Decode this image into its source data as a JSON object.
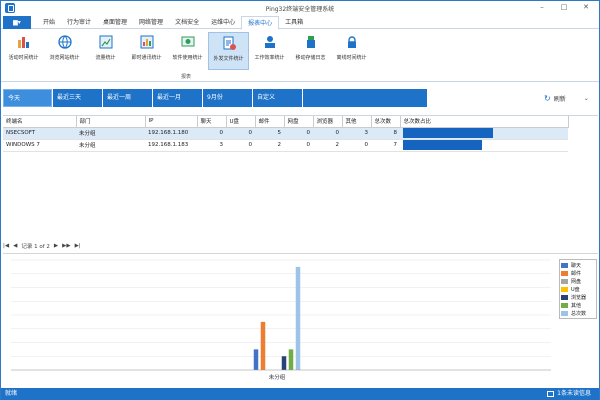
{
  "window": {
    "title": "Ping32终端安全管理系统",
    "min": "–",
    "max": "□",
    "close": "✕"
  },
  "menu": {
    "file_label": "▆▾",
    "tabs": [
      "开始",
      "行为审计",
      "桌面管理",
      "网络管理",
      "文档安全",
      "运维中心",
      "报表中心",
      "工具箱"
    ],
    "active_tab": 6
  },
  "ribbon": {
    "buttons": [
      {
        "label": "活动时间统计",
        "icon": "activity-time-icon"
      },
      {
        "label": "浏览网站统计",
        "icon": "globe-icon"
      },
      {
        "label": "流量统计",
        "icon": "traffic-icon"
      },
      {
        "label": "即时通讯统计",
        "icon": "chat-icon"
      },
      {
        "label": "软件使用统计",
        "icon": "software-icon"
      },
      {
        "label": "外发文件统计",
        "icon": "outgoing-file-icon"
      },
      {
        "label": "工作效率统计",
        "icon": "efficiency-icon"
      },
      {
        "label": "移动存储日志",
        "icon": "usb-icon"
      },
      {
        "label": "离线时间统计",
        "icon": "offline-time-icon"
      }
    ],
    "active_index": 5,
    "group_label": "报表"
  },
  "dates": {
    "options": [
      "今天",
      "最近三天",
      "最近一周",
      "最近一月",
      "9月份",
      "自定义"
    ],
    "active_index": 0
  },
  "refresh": {
    "label": "刷新"
  },
  "table": {
    "columns": [
      "终端名",
      "部门",
      "IP",
      "聊天",
      "U盘",
      "邮件",
      "网盘",
      "浏览器",
      "其他",
      "总次数",
      "总次数占比"
    ],
    "rows": [
      {
        "name": "NSECSOFT",
        "dept": "未分组",
        "ip": "192.168.1.180",
        "chat": "0",
        "udisk": "0",
        "mail": "5",
        "netdisk": "0",
        "browser": "0",
        "other": "3",
        "total": "8",
        "ratio": 1.0
      },
      {
        "name": "WINDOWS 7",
        "dept": "未分组",
        "ip": "192.168.1.183",
        "chat": "3",
        "udisk": "0",
        "mail": "2",
        "netdisk": "0",
        "browser": "2",
        "other": "0",
        "total": "7",
        "ratio": 0.875
      }
    ]
  },
  "pager": {
    "nav_first": "|◀",
    "nav_prev": "◀",
    "text": "记录 1 of 2",
    "nav_next": "▶",
    "nav_next_page": "▶▶",
    "nav_last": "▶|"
  },
  "chart_data": {
    "type": "bar",
    "categories": [
      "未分组"
    ],
    "series": [
      {
        "name": "聊天",
        "values": [
          3
        ],
        "color": "#4472c4"
      },
      {
        "name": "邮件",
        "values": [
          7
        ],
        "color": "#ed7d31"
      },
      {
        "name": "网盘",
        "values": [
          0
        ],
        "color": "#a5a5a5"
      },
      {
        "name": "U盘",
        "values": [
          0
        ],
        "color": "#ffc000"
      },
      {
        "name": "浏览器",
        "values": [
          2
        ],
        "color": "#264478"
      },
      {
        "name": "其他",
        "values": [
          3
        ],
        "color": "#70ad47"
      },
      {
        "name": "总次数",
        "values": [
          15
        ],
        "color": "#9dc3e6"
      }
    ],
    "ylim": [
      0,
      16
    ],
    "grid": true,
    "legend": "right"
  },
  "status": {
    "left": "就绪",
    "right": "1条未读信息"
  }
}
